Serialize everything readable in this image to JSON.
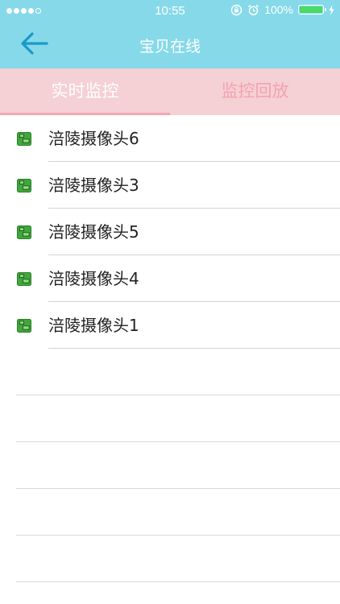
{
  "status_bar": {
    "time": "10:55",
    "battery_percent_label": "100%",
    "battery_fill_fraction": 1.0,
    "signal_dots_filled": 4,
    "signal_dots_total": 5,
    "icons": [
      "rotation-lock-icon",
      "alarm-icon",
      "charging-icon"
    ]
  },
  "header": {
    "title": "宝贝在线",
    "back_icon": "back-arrow-icon"
  },
  "tabs": {
    "live_label": "实时监控",
    "playback_label": "监控回放",
    "active": "live"
  },
  "cameras": [
    {
      "name": "涪陵摄像头6",
      "icon": "camera-device-icon"
    },
    {
      "name": "涪陵摄像头3",
      "icon": "camera-device-icon"
    },
    {
      "name": "涪陵摄像头5",
      "icon": "camera-device-icon"
    },
    {
      "name": "涪陵摄像头4",
      "icon": "camera-device-icon"
    },
    {
      "name": "涪陵摄像头1",
      "icon": "camera-device-icon"
    }
  ],
  "colors": {
    "header_bg": "#86d9e9",
    "tab_bar_bg": "#f5d0d4",
    "inactive_tab_text": "#f1a4ae",
    "back_arrow": "#1a9ac7",
    "camera_icon_green": "#3ea83a"
  }
}
